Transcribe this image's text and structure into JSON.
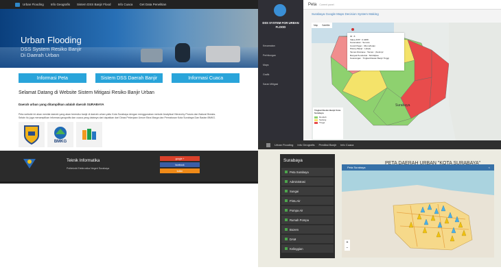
{
  "screen1": {
    "nav": [
      "Urban Flooding",
      "Info Geografis",
      "Sistem DSS Banjir Flood",
      "Info Cuaca",
      "Get Data Penelitian"
    ],
    "hero_title": "Urban Flooding",
    "hero_line1": "DSS System Resiko Banjir",
    "hero_line2": "Di Daerah Urban",
    "buttons": [
      "Informasi Peta",
      "Sistem DSS Daerah Banjir",
      "Informasi Cuaca"
    ],
    "welcome": "Selamat Datang di Website Sistem Mitigasi Resiko Banjir Urban",
    "subtitle": "Daerah urban yang ditampilkan adalah daerah SURABAYA",
    "paragraph": "Peta website ini akan menilai daerah yang akan beresiko banjir di daerah urban yaitu Kota Surabaya dengan menggunakan metode Analytical Hierarchy Proses dan Natural Breaks. Selain itu juga menampilkan informasi geografis dan cuaca yang datanya dari dapatkan dari Dinas Pekerjaan Umum Bina Marga dan Pematusan Kota Surabaya Dan Badan BMKG.",
    "logo_bmkg": "BMKG",
    "footer_title": "Teknik Informatika",
    "footer_sub": "Politeknik Elektronika Negeri Surabaya",
    "social": [
      "google +",
      "facebook",
      "twitter"
    ]
  },
  "screen2": {
    "brand": "DSS SYSTEM FOR URBAN FLOOD",
    "menu": [
      "Kecamatan",
      "Perhitungan",
      "Maps",
      "Grafik",
      "Saran Mitigasi"
    ],
    "page_title": "Peta",
    "page_sub": "Current panel",
    "map_title": "Surabaya Google Maps Decision System Making",
    "map_tabs": [
      "Map",
      "Satellite"
    ],
    "popup": [
      "ID : 8",
      "Value AHP : 0.4488",
      "Kecamatan : Semolo",
      "Curah Hujan : 33mm/bulan",
      "History Banjir : 1(Ked)",
      "Taman Drainase : Taman : (Ketimpr",
      "Banyak Penduduk : 54132jiwa",
      "Keterangan : Tingkat Rawan Banjir Tinggi"
    ],
    "city_label": "Surabaya",
    "legend_title": "Tingkat Resiko Banjir Kota Surabaya",
    "legend": [
      {
        "label": "Rendah",
        "color": "#8ed16f"
      },
      {
        "label": "Sedang",
        "color": "#f4e36a"
      },
      {
        "label": "Tinggi",
        "color": "#e84c4c"
      }
    ]
  },
  "screen3": {
    "nav": [
      "Urban Flooding",
      "Info Geografis",
      "Prediksi Banjir",
      "Info Cuaca"
    ],
    "title": "PETA DAERAH URBAN \"KOTA SURABAYA\"",
    "sidebar_title": "Surabaya",
    "items": [
      "Peta Surabaya",
      "Administrasi",
      "Sungai",
      "Pintu Air",
      "Pompa Air",
      "Rumah Pompa",
      "Bozem",
      "DAM",
      "Kelinggian"
    ],
    "map_bar": "Peta Surabaya"
  }
}
